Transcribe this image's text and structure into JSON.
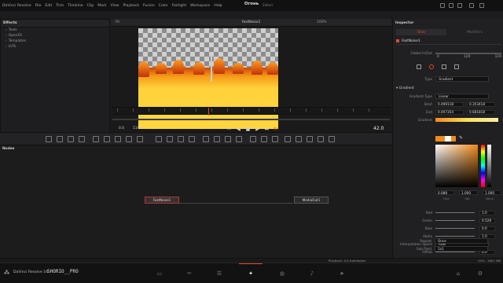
{
  "menubar": {
    "items": [
      "DaVinci Resolve",
      "File",
      "Edit",
      "Trim",
      "Timeline",
      "Clip",
      "Mark",
      "View",
      "Playback",
      "Fusion",
      "Color",
      "Fairlight",
      "Workspace",
      "Help"
    ],
    "project_title": "Огонь",
    "edited": "Edited"
  },
  "effects": {
    "title": "Effects",
    "items": [
      "Tools",
      "OpenFX",
      "Templates",
      "LUTs"
    ]
  },
  "viewer": {
    "fit": "Fit",
    "clip_name": "FastNoise1",
    "zoom": "100%",
    "start_frame": "0.0",
    "end_frame": "119.0",
    "current_frame": "42.0"
  },
  "nodes": {
    "title": "Nodes",
    "node1": "FastNoise1",
    "node2": "MediaOut1"
  },
  "inspector": {
    "title": "Inspector",
    "tab_tools": "Tools",
    "tab_modifiers": "Modifiers",
    "tool_name": "FastNoise1",
    "global_label": "Global In/Out",
    "global_in": "0",
    "global_mid": "120",
    "global_out": "119",
    "type_label": "Type",
    "type_value": "Gradient",
    "section": "Gradient",
    "gradient_type_label": "Gradient Type",
    "gradient_type_value": "Linear",
    "start_label": "Start",
    "start_x": "0.499118",
    "start_y": "0.353418",
    "end_label": "End",
    "end_x": "0.497354",
    "end_y": "0.681818",
    "gradient_label": "Gradient",
    "hue": "0.088",
    "sat": "1.000",
    "val": "1.000",
    "hsv_labels": [
      "Hue",
      "Sat",
      "Value"
    ],
    "red_label": "Red",
    "red_value": "1.0",
    "green_label": "Green",
    "green_value": "0.528",
    "blue_label": "Blue",
    "blue_value": "0.0",
    "alpha_label": "Alpha",
    "alpha_value": "1.0",
    "interp_label": "Interpolation Space",
    "interp_value": "RGB",
    "offset_label": "Offset",
    "offset_value": "0.0",
    "repeat_label": "Repeat",
    "repeat_value": "Once",
    "subpixel_label": "Sub Pixel",
    "subpixel_value": "1x1"
  },
  "status": {
    "playback": "Playback: 4.4 frames/sec",
    "memory": "24% - 1851 MB"
  },
  "pagebar": {
    "app_name": "DaVinci Resolve 16",
    "logo_text": "SHORIO__PRO"
  },
  "colors": {
    "accent": "#e04a2c",
    "gradient_orange": "#f08a1c"
  }
}
